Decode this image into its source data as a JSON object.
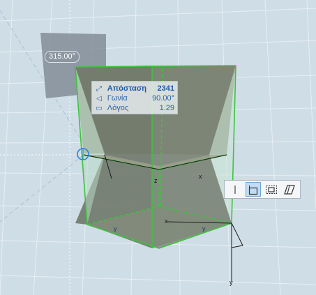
{
  "viewport": {
    "angle_label": "315.00°",
    "axis_labels": {
      "y_left": "y",
      "y_right": "y",
      "x_origin": "x",
      "x_right": "x",
      "z": "z",
      "y_bottom": "y"
    }
  },
  "tracker": {
    "rows": [
      {
        "icon": "distance-icon",
        "label": "Απόσταση",
        "value": "2341",
        "active": true
      },
      {
        "icon": "angle-icon",
        "label": "Γωνία",
        "value": "90.00°",
        "active": false
      },
      {
        "icon": "ratio-icon",
        "label": "Λόγος",
        "value": "1.29",
        "active": false
      }
    ]
  },
  "pet_palette": {
    "buttons": [
      {
        "name": "pet-line-icon",
        "selected": false
      },
      {
        "name": "pet-corner-rectangle-icon",
        "selected": true
      },
      {
        "name": "pet-centered-rectangle-icon",
        "selected": false
      },
      {
        "name": "pet-skewed-rectangle-icon",
        "selected": false
      }
    ]
  },
  "colors": {
    "background": "#cfdde6",
    "grid": "#e7eff4",
    "selection": "#3ec23e",
    "body_fill": "#7d8577",
    "tracker_text": "#2b63a8"
  }
}
